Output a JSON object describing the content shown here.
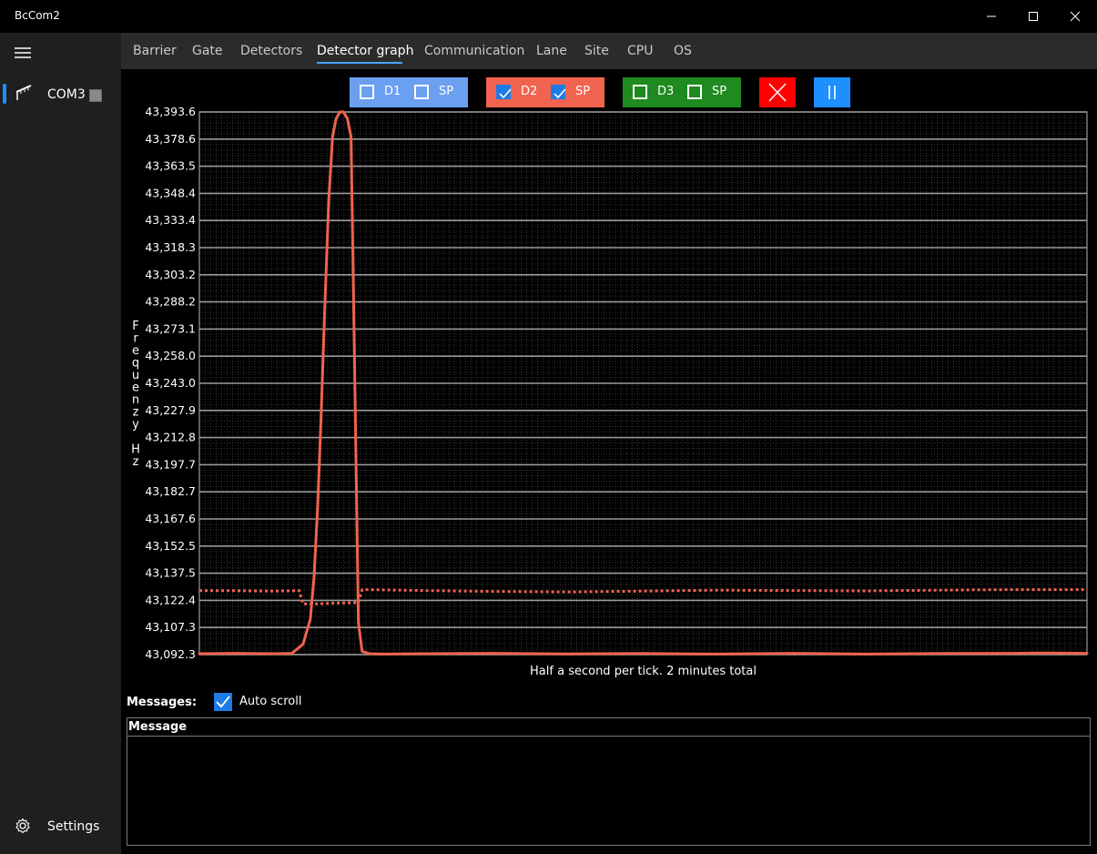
{
  "window": {
    "title": "BcCom2"
  },
  "sidebar": {
    "com_label": "COM3",
    "settings_label": "Settings"
  },
  "tabs": [
    {
      "label": "Barrier"
    },
    {
      "label": "Gate"
    },
    {
      "label": "Detectors"
    },
    {
      "label": "Detector graph",
      "active": true
    },
    {
      "label": "Communication"
    },
    {
      "label": "Lane"
    },
    {
      "label": "Site"
    },
    {
      "label": "CPU"
    },
    {
      "label": "OS"
    }
  ],
  "toolbar": {
    "d1": {
      "label": "D1",
      "sp_label": "SP",
      "checked": false,
      "sp_checked": false,
      "color": "#6b9ff0"
    },
    "d2": {
      "label": "D2",
      "sp_label": "SP",
      "checked": true,
      "sp_checked": true,
      "color": "#f0634e"
    },
    "d3": {
      "label": "D3",
      "sp_label": "SP",
      "checked": false,
      "sp_checked": false,
      "color": "#1f8a1f"
    },
    "clear_color": "#ff0000",
    "pause_color": "#1e8fff"
  },
  "chart_data": {
    "type": "line",
    "ylabel": "Frequenzy Hz",
    "xlabel": "Half a second per tick. 2 minutes total",
    "yticks": [
      "43,393.6",
      "43,378.6",
      "43,363.5",
      "43,348.4",
      "43,333.4",
      "43,318.3",
      "43,303.2",
      "43,288.2",
      "43,273.1",
      "43,258.0",
      "43,243.0",
      "43,227.9",
      "43,212.8",
      "43,197.7",
      "43,182.7",
      "43,167.6",
      "43,152.5",
      "43,137.5",
      "43,122.4",
      "43,107.3",
      "43,092.3"
    ],
    "ylim": [
      43092.3,
      43393.6
    ],
    "xlim": [
      0,
      240
    ],
    "grid": true,
    "series": [
      {
        "name": "D2",
        "color": "#f0634e",
        "style": "solid",
        "x": [
          0,
          10,
          20,
          25,
          28,
          30,
          31,
          32,
          33,
          34,
          35,
          36,
          37,
          38,
          39,
          40,
          41,
          42,
          43,
          44,
          46,
          50,
          60,
          80,
          100,
          120,
          140,
          160,
          180,
          200,
          220,
          230,
          240
        ],
        "y": [
          43092.8,
          43093.0,
          43092.8,
          43093.0,
          43098,
          43112,
          43135,
          43175,
          43230,
          43290,
          43345,
          43380,
          43390,
          43393.6,
          43393.6,
          43390,
          43380,
          43250,
          43110,
          43094,
          43092.8,
          43092.6,
          43092.8,
          43093.0,
          43092.7,
          43092.9,
          43092.6,
          43093.0,
          43092.6,
          43092.9,
          43093.0,
          43093.2,
          43093.0
        ]
      },
      {
        "name": "SP",
        "color": "#f0634e",
        "style": "dotted",
        "x": [
          0,
          10,
          20,
          26,
          27,
          28,
          32,
          36,
          40,
          43,
          44,
          45,
          60,
          80,
          100,
          120,
          140,
          160,
          180,
          200,
          220,
          240
        ],
        "y": [
          43127.8,
          43127.8,
          43127.6,
          43127.8,
          43127.8,
          43120.5,
          43120.5,
          43120.8,
          43121.0,
          43121.2,
          43128.3,
          43128.4,
          43127.9,
          43127.4,
          43127.1,
          43127.6,
          43128.1,
          43127.9,
          43127.7,
          43128.1,
          43128.4,
          43128.4
        ]
      }
    ]
  },
  "messages": {
    "label": "Messages:",
    "auto_scroll_label": "Auto scroll",
    "auto_scroll_checked": true,
    "column_header": "Message"
  }
}
